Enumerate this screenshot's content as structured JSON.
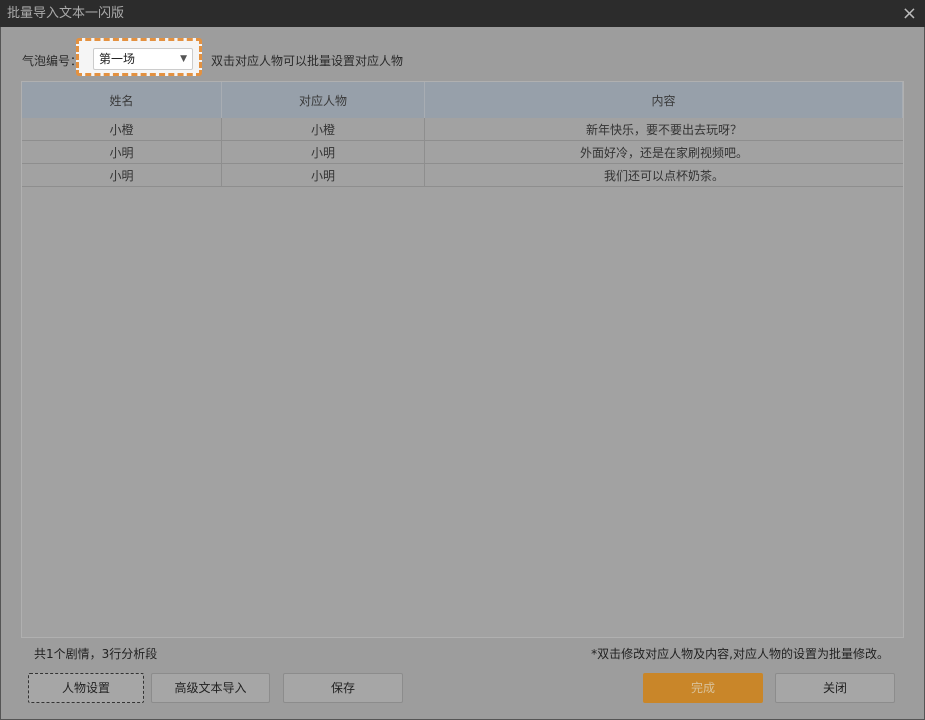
{
  "window": {
    "title": "批量导入文本一闪版",
    "close_icon": "×"
  },
  "bubble": {
    "label": "气泡编号：",
    "selected": "第一场",
    "hint": "双击对应人物可以批量设置对应人物"
  },
  "table": {
    "headers": [
      "姓名",
      "对应人物",
      "内容"
    ],
    "rows": [
      [
        "小橙",
        "小橙",
        "新年快乐，要不要出去玩呀？"
      ],
      [
        "小明",
        "小明",
        "外面好冷，还是在家刷视频吧。"
      ],
      [
        "小明",
        "小明",
        "我们还可以点杯奶茶。"
      ]
    ]
  },
  "footer": {
    "summary": "共1个剧情，3行分析段",
    "note": "*双击修改对应人物及内容,对应人物的设置为批量修改。"
  },
  "buttons": {
    "characters": "人物设置",
    "advanced_import": "高级文本导入",
    "save": "保存",
    "done": "完成",
    "close": "关闭"
  },
  "colors": {
    "accent": "#e39140",
    "primary": "#c98629"
  }
}
